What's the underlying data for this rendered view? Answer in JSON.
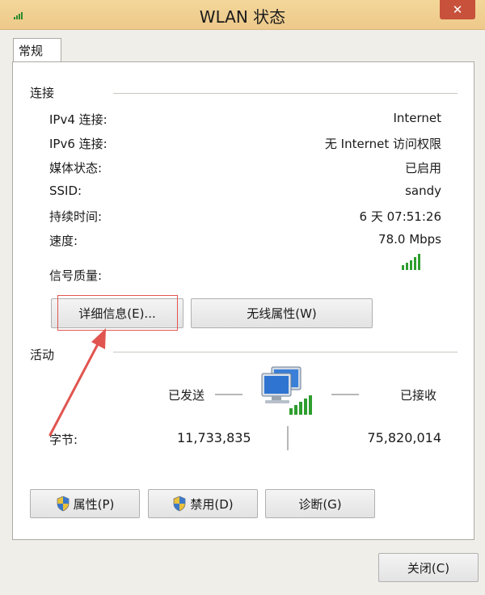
{
  "window": {
    "title": "WLAN 状态",
    "close_glyph": "✕"
  },
  "tabs": [
    {
      "label": "常规"
    }
  ],
  "connection": {
    "group_label": "连接",
    "rows": [
      {
        "label": "IPv4 连接:",
        "value": "Internet"
      },
      {
        "label": "IPv6 连接:",
        "value": "无 Internet 访问权限"
      },
      {
        "label": "媒体状态:",
        "value": "已启用"
      },
      {
        "label": "SSID:",
        "value": "sandy"
      },
      {
        "label": "持续时间:",
        "value": "6 天 07:51:26"
      },
      {
        "label": "速度:",
        "value": "78.0 Mbps"
      }
    ],
    "signal_label": "信号质量:",
    "signal_bars": 5,
    "details_button": "详细信息(E)...",
    "wireless_props_button": "无线属性(W)"
  },
  "activity": {
    "group_label": "活动",
    "sent_label": "已发送",
    "received_label": "已接收",
    "bytes_label": "字节:",
    "bytes_sent": "11,733,835",
    "bytes_received": "75,820,014"
  },
  "actions": {
    "properties_button": "属性(P)",
    "disable_button": "禁用(D)",
    "diagnose_button": "诊断(G)"
  },
  "footer": {
    "close_button": "关闭(C)"
  },
  "colors": {
    "titlebar": "#edc98a",
    "close_red": "#c7513b",
    "annotation_red": "#e15550",
    "signal_green": "#2e9e2e"
  }
}
